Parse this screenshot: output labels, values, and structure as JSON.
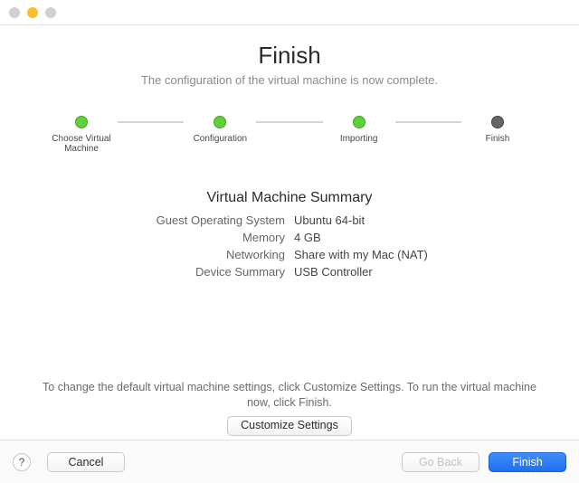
{
  "header": {
    "title": "Finish",
    "subtitle": "The configuration of the virtual machine is now complete."
  },
  "steps": {
    "s1": "Choose Virtual Machine",
    "s2": "Configuration",
    "s3": "Importing",
    "s4": "Finish"
  },
  "summary": {
    "title": "Virtual Machine Summary",
    "rows": {
      "os_k": "Guest Operating System",
      "os_v": "Ubuntu 64-bit",
      "mem_k": "Memory",
      "mem_v": "4 GB",
      "net_k": "Networking",
      "net_v": "Share with my Mac (NAT)",
      "dev_k": "Device Summary",
      "dev_v": "USB Controller"
    }
  },
  "footer": {
    "note": "To change the default virtual machine settings, click Customize Settings. To run the virtual machine now, click Finish.",
    "customize": "Customize Settings"
  },
  "buttons": {
    "help": "?",
    "cancel": "Cancel",
    "back": "Go Back",
    "finish": "Finish"
  }
}
